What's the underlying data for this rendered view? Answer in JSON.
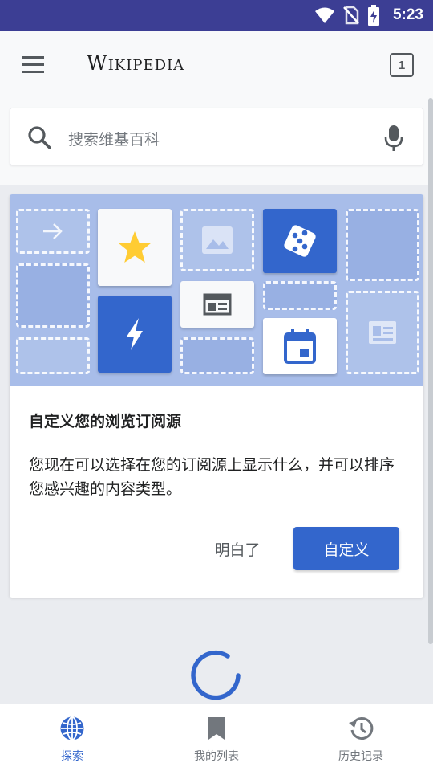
{
  "status_bar": {
    "time": "5:23"
  },
  "app_bar": {
    "wordmark": "Wikipedia",
    "tab_count": "1"
  },
  "search": {
    "placeholder": "搜索维基百科"
  },
  "card": {
    "title": "自定义您的浏览订阅源",
    "body": "您现在可以选择在您的订阅源上显示什么，并可以排序您感兴趣的内容类型。",
    "dismiss_label": "明白了",
    "customize_label": "自定义"
  },
  "bottom_nav": {
    "items": [
      {
        "label": "探索",
        "icon": "globe-icon",
        "active": true
      },
      {
        "label": "我的列表",
        "icon": "bookmark-icon",
        "active": false
      },
      {
        "label": "历史记录",
        "icon": "history-icon",
        "active": false
      }
    ]
  },
  "colors": {
    "status_bar": "#3c3e94",
    "accent": "#3366cc",
    "hero_bg": "#a8bde9",
    "star": "#fc3"
  }
}
